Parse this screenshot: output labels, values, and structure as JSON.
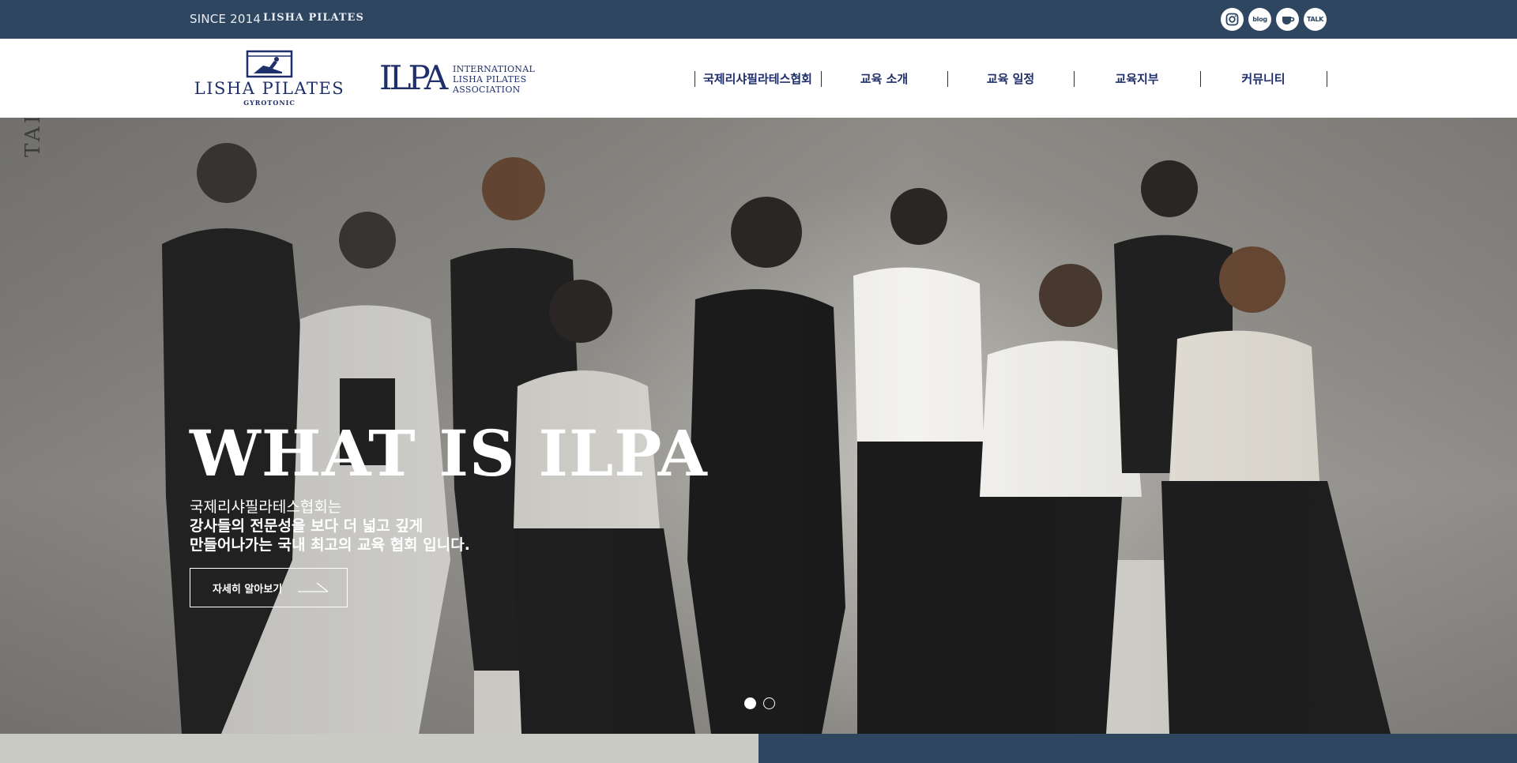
{
  "topbar": {
    "since": "SINCE 2014",
    "brand": "LISHA PILATES",
    "social": [
      {
        "name": "instagram-icon",
        "label": ""
      },
      {
        "name": "blog-icon",
        "label": "blog"
      },
      {
        "name": "cafe-icon",
        "label": ""
      },
      {
        "name": "kakaotalk-icon",
        "label": "TALK"
      }
    ]
  },
  "header": {
    "logo1": {
      "main": "LISHA PILATES",
      "sub": "GYROTONIC"
    },
    "logo2": {
      "big": "ILPA",
      "line1": "INTERNATIONAL",
      "line2": "LISHA PILATES",
      "line3": "ASSOCIATION"
    },
    "nav": [
      {
        "label": "국제리샤필라테스협회"
      },
      {
        "label": "교육 소개"
      },
      {
        "label": "교육 일정"
      },
      {
        "label": "교육지부"
      },
      {
        "label": "커뮤니티"
      }
    ]
  },
  "hero": {
    "side_text": "TAI",
    "title": "WHAT IS ILPA",
    "desc_line1": "국제리샤필라테스협회는",
    "desc_line2": "강사들의 전문성을 보다 더 넓고 깊게",
    "desc_line3": "만들어나가는 국내 최고의 교육 협회 입니다.",
    "button_label": "자세히 알아보기",
    "slides": [
      {
        "active": true
      },
      {
        "active": false
      }
    ]
  },
  "colors": {
    "navy": "#2f4661",
    "brand_blue": "#1f2f6b",
    "strip_left": "#c9cac3"
  }
}
